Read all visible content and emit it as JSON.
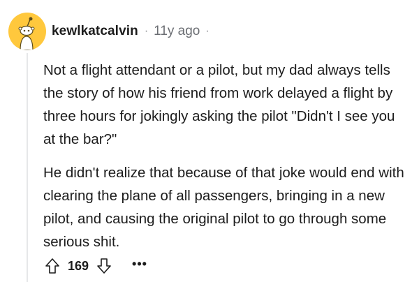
{
  "comment": {
    "author": "kewlkatcalvin",
    "separator": "·",
    "age": "11y ago",
    "paragraphs": [
      "Not a flight attendant or a pilot, but my dad always tells the story of how his friend from work delayed a flight by three hours for jokingly asking the pilot \"Didn't I see you at the bar?\"",
      "He didn't realize that because of that joke would end with clearing the plane of all passengers, bringing in a new pilot, and causing the original pilot to go through some serious shit."
    ],
    "score": "169",
    "more_label": "•••",
    "icons": {
      "avatar": "snoo-avatar-icon",
      "upvote": "upvote-arrow-icon",
      "downvote": "downvote-arrow-icon",
      "more": "ellipsis-icon"
    }
  },
  "colors": {
    "avatar_bg": "#ffc83d",
    "text": "#1c1c1c",
    "muted": "#6b6e73",
    "thread_line": "#e6e7e9"
  }
}
